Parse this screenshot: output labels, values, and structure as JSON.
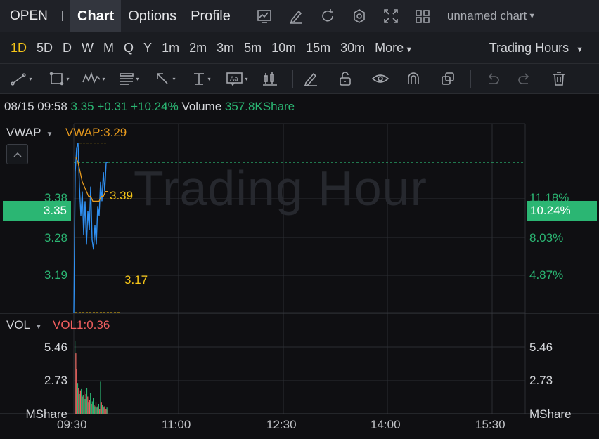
{
  "topnav": {
    "ticker": "OPEN",
    "tabs": [
      "Chart",
      "Options",
      "Profile"
    ],
    "active_tab": "Chart",
    "icons": [
      "line-chart-icon",
      "draw-icon",
      "refresh-icon",
      "settings-icon",
      "fullscreen-icon",
      "layout-grid-icon"
    ],
    "chart_name": "unnamed chart"
  },
  "intervals": {
    "items": [
      "1D",
      "5D",
      "D",
      "W",
      "M",
      "Q",
      "Y",
      "1m",
      "2m",
      "3m",
      "5m",
      "10m",
      "15m",
      "30m"
    ],
    "active": "1D",
    "more_label": "More",
    "session_label": "Trading Hours"
  },
  "tools": [
    "trend-line-icon",
    "rectangle-icon",
    "pattern-icon",
    "fibonacci-icon",
    "arrow-icon",
    "measure-icon",
    "text-note-icon",
    "candle-icon",
    "pencil-icon",
    "lock-icon",
    "eye-icon",
    "magnet-icon",
    "copy-icon",
    "undo-icon",
    "redo-icon",
    "trash-icon"
  ],
  "info": {
    "datetime": "08/15 09:58",
    "price": "3.35",
    "change": "+0.31",
    "change_pct": "+10.24%",
    "volume_label": "Volume",
    "volume": "357.8KShare"
  },
  "price_pane": {
    "indicator": "VWAP",
    "indicator_value": "VWAP:3.29",
    "watermark": "Trading Hour",
    "left_ticks": [
      "3.38",
      "3.28",
      "3.19"
    ],
    "right_ticks": [
      "11.18%",
      "8.03%",
      "4.87%"
    ],
    "current_price": "3.35",
    "current_pct": "10.24%",
    "high_label": "3.39",
    "low_label": "3.17"
  },
  "volume_pane": {
    "indicator": "VOL",
    "indicator_value": "VOL1:0.36",
    "left_ticks": [
      "5.46",
      "2.73"
    ],
    "right_ticks": [
      "5.46",
      "2.73"
    ],
    "unit_left": "MShare",
    "unit_right": "MShare"
  },
  "x_axis": [
    "09:30",
    "11:00",
    "12:30",
    "14:00",
    "15:30"
  ],
  "colors": {
    "up": "#2bb673",
    "down": "#ef5e5e",
    "price_line": "#2f8ff0",
    "vwap_line": "#e99b1d",
    "highlight": "#f5c518",
    "active_interval": "#f5c518"
  },
  "chart_data": {
    "type": "line",
    "y_unit": "price",
    "price": [
      3.04,
      3.33,
      3.38,
      3.39,
      3.3,
      3.24,
      3.29,
      3.2,
      3.27,
      3.18,
      3.25,
      3.21,
      3.3,
      3.19,
      3.17,
      3.22,
      3.18,
      3.26,
      3.24,
      3.31,
      3.27,
      3.33,
      3.29,
      3.35,
      3.35
    ],
    "vwap": [
      3.36,
      3.35,
      3.33,
      3.31,
      3.3,
      3.29,
      3.28,
      3.28,
      3.27,
      3.27,
      3.27,
      3.27,
      3.28,
      3.28,
      3.29,
      3.29
    ],
    "volume_millions": [
      5.9,
      4.9,
      3.6,
      2.5,
      2.1,
      1.6,
      1.9,
      2.0,
      1.4,
      1.5,
      1.8,
      1.2,
      1.6,
      2.1,
      1.4,
      0.9,
      1.1,
      1.7,
      0.8,
      1.0,
      1.3,
      0.7,
      0.6,
      0.9,
      0.5,
      0.6,
      0.8,
      0.4,
      2.6,
      0.9,
      0.7,
      0.5,
      0.6,
      0.3,
      0.4,
      0.5,
      0.3
    ],
    "volume_up": [
      true,
      false,
      false,
      true,
      false,
      true,
      false,
      true,
      false,
      true,
      false,
      true,
      false,
      true,
      false,
      true,
      false,
      true,
      false,
      true,
      true,
      false,
      true,
      false,
      true,
      false,
      true,
      false,
      true,
      false,
      true,
      true,
      false,
      true,
      false,
      true,
      false
    ],
    "ylim": [
      3.04,
      3.43
    ],
    "volume_ylim": [
      0,
      8.1
    ],
    "x_range": [
      "09:30",
      "16:00"
    ]
  }
}
